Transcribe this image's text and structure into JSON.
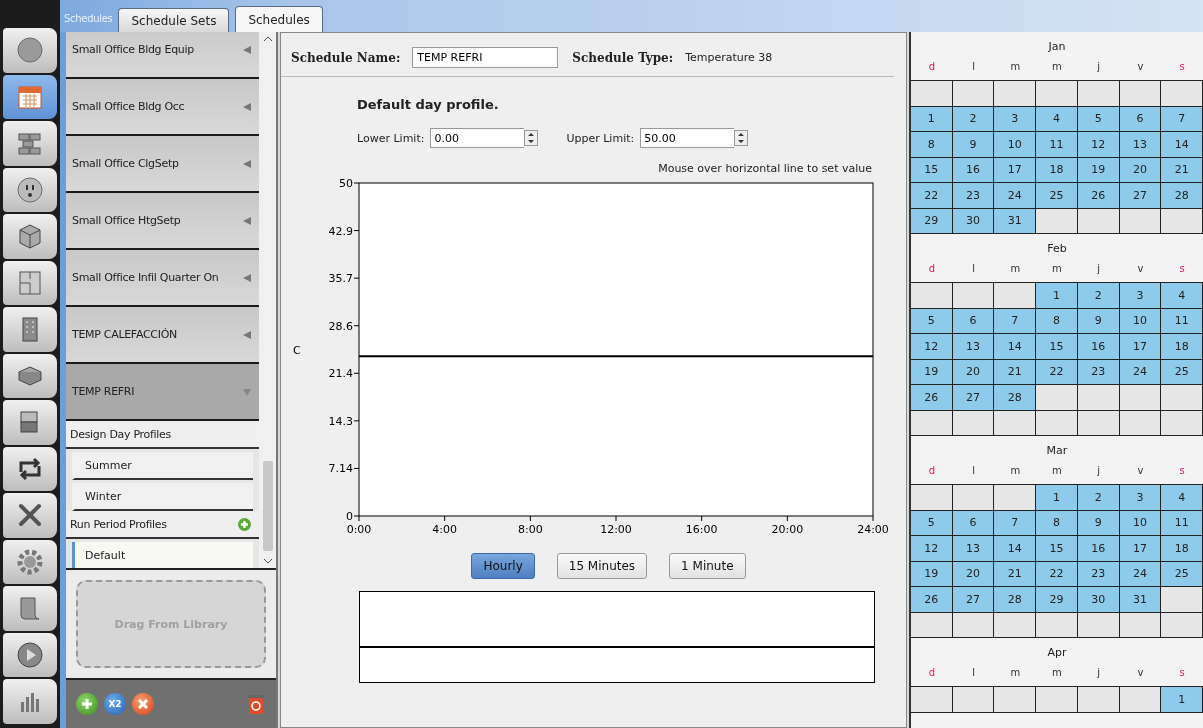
{
  "tabs": {
    "caption": "Schedules",
    "items": [
      {
        "label": "Schedule Sets",
        "selected": false
      },
      {
        "label": "Schedules",
        "selected": true
      }
    ]
  },
  "nav": [
    {
      "selected": false
    },
    {
      "selected": true
    },
    {
      "selected": false
    },
    {
      "selected": false
    },
    {
      "selected": false
    },
    {
      "selected": false
    },
    {
      "selected": false
    },
    {
      "selected": false
    },
    {
      "selected": false
    },
    {
      "selected": false
    },
    {
      "selected": false
    },
    {
      "selected": false
    },
    {
      "selected": false
    },
    {
      "selected": false
    },
    {
      "selected": false
    }
  ],
  "schedules": [
    {
      "name": "Small Office Bldg Equip",
      "expanded": false
    },
    {
      "name": "Small Office Bldg Occ",
      "expanded": false
    },
    {
      "name": "Small Office ClgSetp",
      "expanded": false
    },
    {
      "name": "Small Office HtgSetp",
      "expanded": false
    },
    {
      "name": "Small Office Infil Quarter On",
      "expanded": false
    },
    {
      "name": "TEMP CALEFACCIÓN",
      "expanded": false
    },
    {
      "name": "TEMP REFRI",
      "expanded": true,
      "sections": [
        {
          "title": "Design Day Profiles",
          "addable": false,
          "profiles": [
            {
              "name": "Summer",
              "selected": false
            },
            {
              "name": "Winter",
              "selected": false
            }
          ]
        },
        {
          "title": "Run Period Profiles",
          "addable": true,
          "profiles": [
            {
              "name": "Default",
              "selected": true
            }
          ]
        }
      ]
    }
  ],
  "drop_zone": "Drag From Library",
  "toolbar": {
    "duplicate_label": "X2"
  },
  "schedule": {
    "name_label": "Schedule Name:",
    "name": "TEMP REFRI",
    "type_label": "Schedule Type:",
    "type": "Temperature 38"
  },
  "profile": {
    "title": "Default day profile.",
    "lower_label": "Lower Limit:",
    "lower": "0.00",
    "upper_label": "Upper Limit:",
    "upper": "50.00",
    "hint": "Mouse over horizontal line to set value",
    "chart_data": {
      "type": "line",
      "ylabel": "C",
      "x": [
        0,
        24
      ],
      "series": [
        {
          "color": "#000000",
          "values": [
            24,
            24
          ]
        }
      ],
      "xlim": [
        0,
        24
      ],
      "ylim": [
        0,
        50
      ],
      "xticks": [
        {
          "value": 0,
          "label": "0:00"
        },
        {
          "value": 4,
          "label": "4:00"
        },
        {
          "value": 8,
          "label": "8:00"
        },
        {
          "value": 12,
          "label": "12:00"
        },
        {
          "value": 16,
          "label": "16:00"
        },
        {
          "value": 20,
          "label": "20:00"
        },
        {
          "value": 24,
          "label": "24:00"
        }
      ],
      "yticks": [
        {
          "value": 0,
          "label": "0"
        },
        {
          "value": 7.14,
          "label": "7.14"
        },
        {
          "value": 14.29,
          "label": "14.3"
        },
        {
          "value": 21.43,
          "label": "21.4"
        },
        {
          "value": 28.57,
          "label": "28.6"
        },
        {
          "value": 35.71,
          "label": "35.7"
        },
        {
          "value": 42.86,
          "label": "42.9"
        },
        {
          "value": 50,
          "label": "50"
        }
      ]
    },
    "resolutions": [
      {
        "label": "Hourly",
        "selected": true
      },
      {
        "label": "15 Minutes",
        "selected": false
      },
      {
        "label": "1 Minute",
        "selected": false
      }
    ]
  },
  "calendar": {
    "months": [
      {
        "name": "Jan",
        "weekdays": [
          {
            "label": "d",
            "weekend": true
          },
          {
            "label": "l",
            "weekend": false
          },
          {
            "label": "m",
            "weekend": false
          },
          {
            "label": "m",
            "weekend": false
          },
          {
            "label": "j",
            "weekend": false
          },
          {
            "label": "v",
            "weekend": false
          },
          {
            "label": "s",
            "weekend": true
          }
        ],
        "weeks": [
          [
            {
              "active": false
            },
            {
              "active": false
            },
            {
              "active": false
            },
            {
              "active": false
            },
            {
              "active": false
            },
            {
              "active": false
            },
            {
              "active": false
            }
          ],
          [
            {
              "active": true,
              "day": "1"
            },
            {
              "active": true,
              "day": "2"
            },
            {
              "active": true,
              "day": "3"
            },
            {
              "active": true,
              "day": "4"
            },
            {
              "active": true,
              "day": "5"
            },
            {
              "active": true,
              "day": "6"
            },
            {
              "active": true,
              "day": "7"
            }
          ],
          [
            {
              "active": true,
              "day": "8"
            },
            {
              "active": true,
              "day": "9"
            },
            {
              "active": true,
              "day": "10"
            },
            {
              "active": true,
              "day": "11"
            },
            {
              "active": true,
              "day": "12"
            },
            {
              "active": true,
              "day": "13"
            },
            {
              "active": true,
              "day": "14"
            }
          ],
          [
            {
              "active": true,
              "day": "15"
            },
            {
              "active": true,
              "day": "16"
            },
            {
              "active": true,
              "day": "17"
            },
            {
              "active": true,
              "day": "18"
            },
            {
              "active": true,
              "day": "19"
            },
            {
              "active": true,
              "day": "20"
            },
            {
              "active": true,
              "day": "21"
            }
          ],
          [
            {
              "active": true,
              "day": "22"
            },
            {
              "active": true,
              "day": "23"
            },
            {
              "active": true,
              "day": "24"
            },
            {
              "active": true,
              "day": "25"
            },
            {
              "active": true,
              "day": "26"
            },
            {
              "active": true,
              "day": "27"
            },
            {
              "active": true,
              "day": "28"
            }
          ],
          [
            {
              "active": true,
              "day": "29"
            },
            {
              "active": true,
              "day": "30"
            },
            {
              "active": true,
              "day": "31"
            },
            {
              "active": false
            },
            {
              "active": false
            },
            {
              "active": false
            },
            {
              "active": false
            }
          ]
        ]
      },
      {
        "name": "Feb",
        "weekdays": [
          {
            "label": "d",
            "weekend": true
          },
          {
            "label": "l",
            "weekend": false
          },
          {
            "label": "m",
            "weekend": false
          },
          {
            "label": "m",
            "weekend": false
          },
          {
            "label": "j",
            "weekend": false
          },
          {
            "label": "v",
            "weekend": false
          },
          {
            "label": "s",
            "weekend": true
          }
        ],
        "weeks": [
          [
            {
              "active": false
            },
            {
              "active": false
            },
            {
              "active": false
            },
            {
              "active": true,
              "day": "1"
            },
            {
              "active": true,
              "day": "2"
            },
            {
              "active": true,
              "day": "3"
            },
            {
              "active": true,
              "day": "4"
            }
          ],
          [
            {
              "active": true,
              "day": "5"
            },
            {
              "active": true,
              "day": "6"
            },
            {
              "active": true,
              "day": "7"
            },
            {
              "active": true,
              "day": "8"
            },
            {
              "active": true,
              "day": "9"
            },
            {
              "active": true,
              "day": "10"
            },
            {
              "active": true,
              "day": "11"
            }
          ],
          [
            {
              "active": true,
              "day": "12"
            },
            {
              "active": true,
              "day": "13"
            },
            {
              "active": true,
              "day": "14"
            },
            {
              "active": true,
              "day": "15"
            },
            {
              "active": true,
              "day": "16"
            },
            {
              "active": true,
              "day": "17"
            },
            {
              "active": true,
              "day": "18"
            }
          ],
          [
            {
              "active": true,
              "day": "19"
            },
            {
              "active": true,
              "day": "20"
            },
            {
              "active": true,
              "day": "21"
            },
            {
              "active": true,
              "day": "22"
            },
            {
              "active": true,
              "day": "23"
            },
            {
              "active": true,
              "day": "24"
            },
            {
              "active": true,
              "day": "25"
            }
          ],
          [
            {
              "active": true,
              "day": "26"
            },
            {
              "active": true,
              "day": "27"
            },
            {
              "active": true,
              "day": "28"
            },
            {
              "active": false
            },
            {
              "active": false
            },
            {
              "active": false
            },
            {
              "active": false
            }
          ],
          [
            {
              "active": false
            },
            {
              "active": false
            },
            {
              "active": false
            },
            {
              "active": false
            },
            {
              "active": false
            },
            {
              "active": false
            },
            {
              "active": false
            }
          ]
        ]
      },
      {
        "name": "Mar",
        "weekdays": [
          {
            "label": "d",
            "weekend": true
          },
          {
            "label": "l",
            "weekend": false
          },
          {
            "label": "m",
            "weekend": false
          },
          {
            "label": "m",
            "weekend": false
          },
          {
            "label": "j",
            "weekend": false
          },
          {
            "label": "v",
            "weekend": false
          },
          {
            "label": "s",
            "weekend": true
          }
        ],
        "weeks": [
          [
            {
              "active": false
            },
            {
              "active": false
            },
            {
              "active": false
            },
            {
              "active": true,
              "day": "1"
            },
            {
              "active": true,
              "day": "2"
            },
            {
              "active": true,
              "day": "3"
            },
            {
              "active": true,
              "day": "4"
            }
          ],
          [
            {
              "active": true,
              "day": "5"
            },
            {
              "active": true,
              "day": "6"
            },
            {
              "active": true,
              "day": "7"
            },
            {
              "active": true,
              "day": "8"
            },
            {
              "active": true,
              "day": "9"
            },
            {
              "active": true,
              "day": "10"
            },
            {
              "active": true,
              "day": "11"
            }
          ],
          [
            {
              "active": true,
              "day": "12"
            },
            {
              "active": true,
              "day": "13"
            },
            {
              "active": true,
              "day": "14"
            },
            {
              "active": true,
              "day": "15"
            },
            {
              "active": true,
              "day": "16"
            },
            {
              "active": true,
              "day": "17"
            },
            {
              "active": true,
              "day": "18"
            }
          ],
          [
            {
              "active": true,
              "day": "19"
            },
            {
              "active": true,
              "day": "20"
            },
            {
              "active": true,
              "day": "21"
            },
            {
              "active": true,
              "day": "22"
            },
            {
              "active": true,
              "day": "23"
            },
            {
              "active": true,
              "day": "24"
            },
            {
              "active": true,
              "day": "25"
            }
          ],
          [
            {
              "active": true,
              "day": "26"
            },
            {
              "active": true,
              "day": "27"
            },
            {
              "active": true,
              "day": "28"
            },
            {
              "active": true,
              "day": "29"
            },
            {
              "active": true,
              "day": "30"
            },
            {
              "active": true,
              "day": "31"
            },
            {
              "active": false
            }
          ],
          [
            {
              "active": false
            },
            {
              "active": false
            },
            {
              "active": false
            },
            {
              "active": false
            },
            {
              "active": false
            },
            {
              "active": false
            },
            {
              "active": false
            }
          ]
        ]
      },
      {
        "name": "Apr",
        "weekdays": [
          {
            "label": "d",
            "weekend": true
          },
          {
            "label": "l",
            "weekend": false
          },
          {
            "label": "m",
            "weekend": false
          },
          {
            "label": "m",
            "weekend": false
          },
          {
            "label": "j",
            "weekend": false
          },
          {
            "label": "v",
            "weekend": false
          },
          {
            "label": "s",
            "weekend": true
          }
        ],
        "weeks": [
          [
            {
              "active": false
            },
            {
              "active": false
            },
            {
              "active": false
            },
            {
              "active": false
            },
            {
              "active": false
            },
            {
              "active": false
            },
            {
              "active": true,
              "day": "1"
            }
          ]
        ]
      }
    ]
  }
}
